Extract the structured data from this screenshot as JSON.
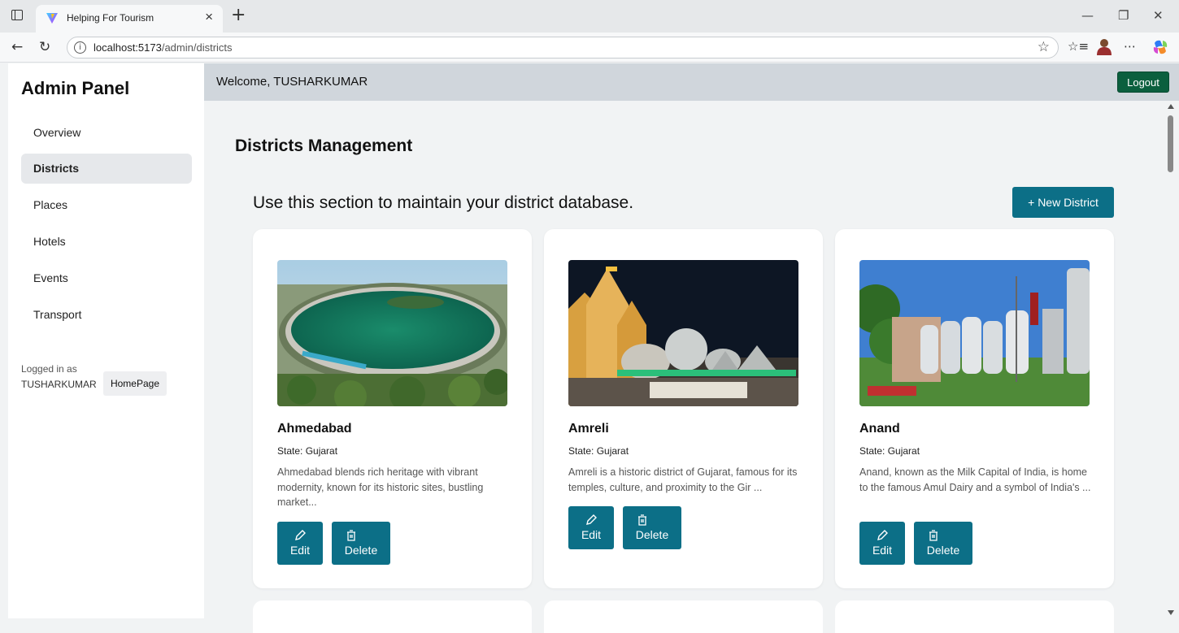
{
  "browser": {
    "tab_title": "Helping For Tourism",
    "tab_close": "×",
    "new_tab": "+",
    "url_host": "localhost:5173",
    "url_path": "/admin/districts",
    "controls": {
      "minimize": "—",
      "restore": "❐",
      "close": "✕"
    }
  },
  "sidebar": {
    "title": "Admin Panel",
    "items": [
      {
        "label": "Overview",
        "active": false
      },
      {
        "label": "Districts",
        "active": true
      },
      {
        "label": "Places",
        "active": false
      },
      {
        "label": "Hotels",
        "active": false
      },
      {
        "label": "Events",
        "active": false
      },
      {
        "label": "Transport",
        "active": false
      }
    ],
    "logged_in_label": "Logged in as",
    "username": "TUSHARKUMAR",
    "homepage_label": "HomePage"
  },
  "topbar": {
    "welcome": "Welcome, TUSHARKUMAR",
    "logout_label": "Logout"
  },
  "main": {
    "title": "Districts Management",
    "section_text": "Use this section to maintain your district database.",
    "new_district_label": "+ New District",
    "cards": [
      {
        "name": "Ahmedabad",
        "state": "State: Gujarat",
        "description": "Ahmedabad blends rich heritage with vibrant modernity, known for its historic sites, bustling market...",
        "edit_label": "Edit",
        "delete_label": "Delete"
      },
      {
        "name": "Amreli",
        "state": "State: Gujarat",
        "description": "Amreli is a historic district of Gujarat, famous for its temples, culture, and proximity to the Gir ...",
        "edit_label": "Edit",
        "delete_label": "Delete"
      },
      {
        "name": "Anand",
        "state": "State: Gujarat",
        "description": "Anand, known as the Milk Capital of India, is home to the famous Amul Dairy and a symbol of India's ...",
        "edit_label": "Edit",
        "delete_label": "Delete"
      }
    ]
  },
  "colors": {
    "primary_button": "#0c6f87",
    "logout_button": "#0b5f3e",
    "topbar": "#d0d6dc",
    "page_background": "#f1f3f4"
  }
}
